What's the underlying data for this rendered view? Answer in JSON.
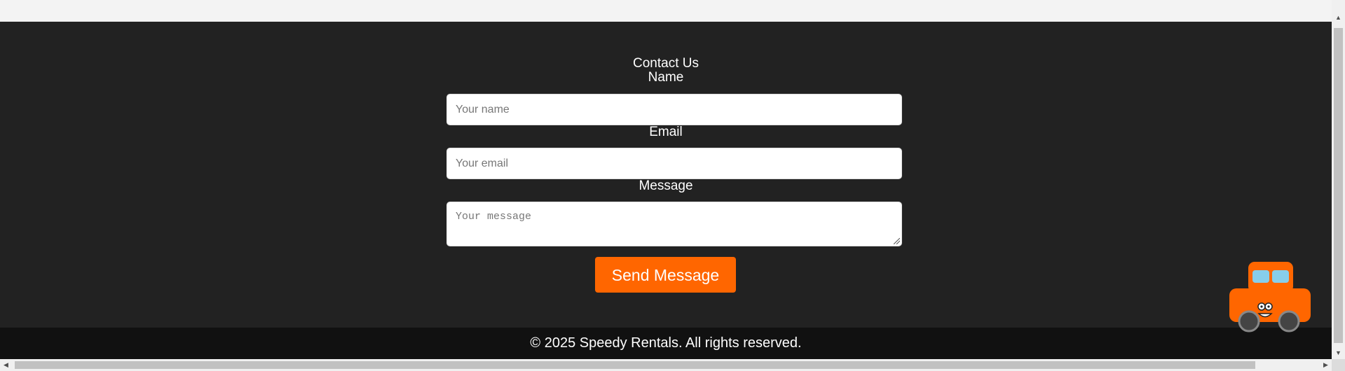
{
  "contact": {
    "title": "Contact Us",
    "name_label": "Name",
    "name_placeholder": "Your name",
    "email_label": "Email",
    "email_placeholder": "Your email",
    "message_label": "Message",
    "message_placeholder": "Your message",
    "send_label": "Send Message"
  },
  "footer": {
    "text": "© 2025 Speedy Rentals. All rights reserved."
  },
  "mascot": {
    "icon": "car-mascot-icon"
  },
  "colors": {
    "section_bg": "#222222",
    "footer_bg": "#111111",
    "accent": "#ff6600",
    "window_glass": "#87ceeb"
  }
}
